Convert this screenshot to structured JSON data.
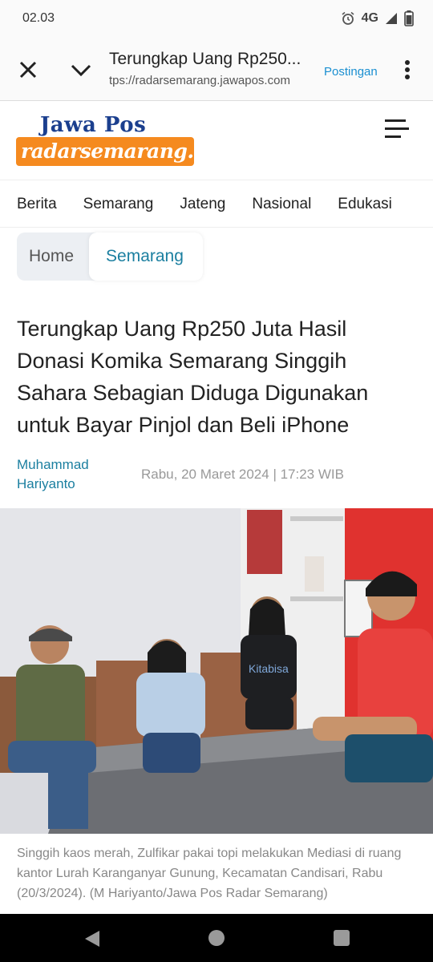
{
  "status_bar": {
    "time": "02.03",
    "network": "4G"
  },
  "browser": {
    "title": "Terungkap Uang Rp250...",
    "url": "tps://radarsemarang.jawapos.com",
    "action_label": "Postingan"
  },
  "site": {
    "logo_top": "Jawa Pos",
    "logo_bottom": "radarsemarang.id",
    "brand_colors": {
      "blue": "#1b3f8e",
      "orange": "#f58a1f"
    }
  },
  "nav": {
    "items": [
      "Berita",
      "Semarang",
      "Jateng",
      "Nasional",
      "Edukasi"
    ]
  },
  "breadcrumb": {
    "home": "Home",
    "current": "Semarang"
  },
  "article": {
    "headline": "Terungkap Uang Rp250 Juta Hasil Donasi Komika Semarang Singgih Sahara Sebagian Diduga Digunakan untuk Bayar Pinjol dan Beli iPhone",
    "author": "Muhammad Hariyanto",
    "date": "Rabu, 20 Maret 2024 | 17:23 WIB",
    "photo_shirt_text": "Kitabisa",
    "caption": "Singgih kaos merah, Zulfikar pakai topi melakukan Mediasi di ruang kantor Lurah Karanganyar Gunung, Kecamatan Candisari, Rabu (20/3/2024). (M Hariyanto/Jawa Pos Radar Semarang)"
  },
  "icons": {
    "close": "close-icon",
    "chevron": "chevron-down-icon",
    "menu": "more-vert-icon",
    "hamburger": "hamburger-icon",
    "alarm": "alarm-icon",
    "signal": "signal-icon",
    "battery": "battery-icon"
  }
}
